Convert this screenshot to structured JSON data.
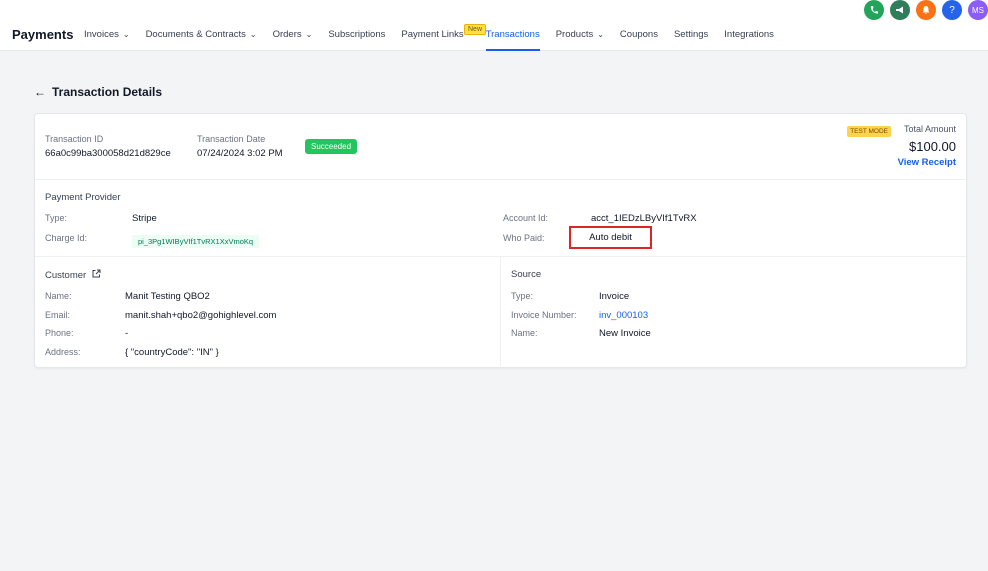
{
  "app": {
    "brand": "Payments"
  },
  "nav": {
    "items": [
      {
        "label": "Invoices",
        "chevron": true,
        "active": false
      },
      {
        "label": "Documents & Contracts",
        "chevron": true,
        "active": false
      },
      {
        "label": "Orders",
        "chevron": true,
        "active": false
      },
      {
        "label": "Subscriptions",
        "chevron": false,
        "active": false
      },
      {
        "label": "Payment Links",
        "chevron": false,
        "active": false
      },
      {
        "label": "Transactions",
        "chevron": false,
        "active": true
      },
      {
        "label": "Products",
        "chevron": true,
        "active": false
      },
      {
        "label": "Coupons",
        "chevron": false,
        "active": false
      },
      {
        "label": "Settings",
        "chevron": false,
        "active": false
      },
      {
        "label": "Integrations",
        "chevron": false,
        "active": false
      }
    ],
    "new_badge": "New"
  },
  "top_icons": {
    "phone": "phone-icon",
    "announcement": "megaphone-icon",
    "notifications": "bell-icon",
    "help": "help-icon",
    "avatar_initials": "MS"
  },
  "page": {
    "back_icon": "arrow-left-icon",
    "title": "Transaction Details"
  },
  "transaction": {
    "id_label": "Transaction ID",
    "id_value": "66a0c99ba300058d21d829ce",
    "date_label": "Transaction Date",
    "date_value": "07/24/2024 3:02 PM",
    "status": "Succeeded",
    "test_mode": "TEST MODE",
    "total_label": "Total Amount",
    "total_value": "$100.00",
    "view_receipt": "View Receipt"
  },
  "provider": {
    "heading": "Payment Provider",
    "type_label": "Type:",
    "type_value": "Stripe",
    "charge_label": "Charge Id:",
    "charge_value": "pi_3Pg1WIByVIf1TvRX1XxVmoKq",
    "account_label": "Account Id:",
    "account_value": "acct_1IEDzLByVIf1TvRX",
    "who_paid_label": "Who Paid:",
    "who_paid_value": "Auto debit"
  },
  "customer": {
    "heading": "Customer",
    "external_icon": "external-link-icon",
    "name_label": "Name:",
    "name_value": "Manit Testing QBO2",
    "email_label": "Email:",
    "email_value": "manit.shah+qbo2@gohighlevel.com",
    "phone_label": "Phone:",
    "phone_value": "-",
    "address_label": "Address:",
    "address_value": "{ \"countryCode\": \"IN\" }"
  },
  "source": {
    "heading": "Source",
    "type_label": "Type:",
    "type_value": "Invoice",
    "invoice_label": "Invoice Number:",
    "invoice_value": "inv_000103",
    "name_label": "Name:",
    "name_value": "New Invoice"
  },
  "colors": {
    "primary": "#155eef",
    "success": "#22c55e",
    "highlight_border": "#dc2626"
  }
}
